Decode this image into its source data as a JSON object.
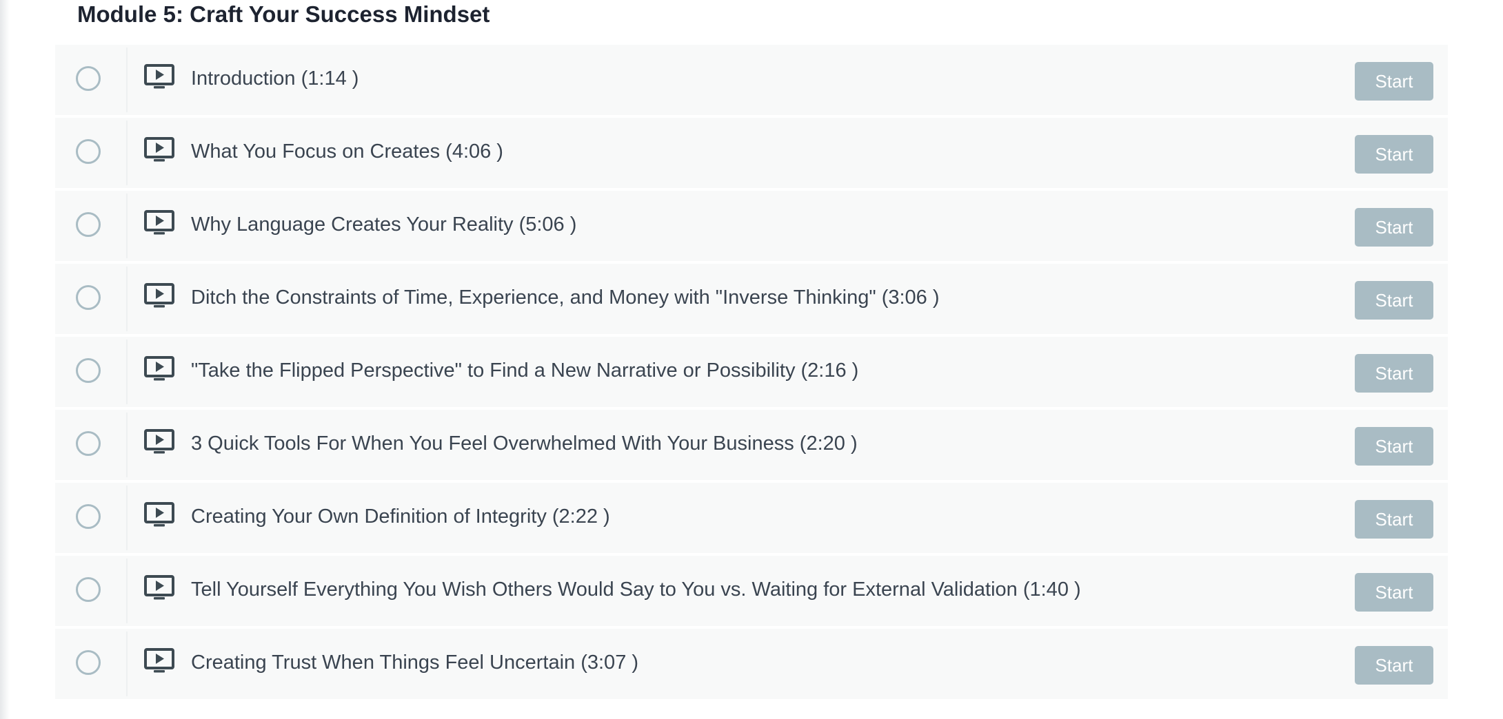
{
  "module": {
    "title": "Module 5: Craft Your Success Mindset"
  },
  "lecture_icon": "video-play-icon",
  "colors": {
    "button_bg": "#a9bcc4",
    "row_bg": "#f8f9f9",
    "title_text": "#1d2330",
    "lecture_text": "#3a4450"
  },
  "lectures": [
    {
      "title": "Introduction (1:14 )",
      "button_label": "Start",
      "completed": false
    },
    {
      "title": "What You Focus on Creates (4:06 )",
      "button_label": "Start",
      "completed": false
    },
    {
      "title": "Why Language Creates Your Reality (5:06 )",
      "button_label": "Start",
      "completed": false
    },
    {
      "title": "Ditch the Constraints of Time, Experience, and Money with \"Inverse Thinking\" (3:06 )",
      "button_label": "Start",
      "completed": false
    },
    {
      "title": "\"Take the Flipped Perspective\" to Find a New Narrative or Possibility (2:16 )",
      "button_label": "Start",
      "completed": false
    },
    {
      "title": "3 Quick Tools For When You Feel Overwhelmed With Your Business (2:20 )",
      "button_label": "Start",
      "completed": false
    },
    {
      "title": "Creating Your Own Definition of Integrity (2:22 )",
      "button_label": "Start",
      "completed": false
    },
    {
      "title": "Tell Yourself Everything You Wish Others Would Say to You vs. Waiting for External Validation (1:40 )",
      "button_label": "Start",
      "completed": false
    },
    {
      "title": "Creating Trust When Things Feel Uncertain (3:07 )",
      "button_label": "Start",
      "completed": false
    }
  ]
}
